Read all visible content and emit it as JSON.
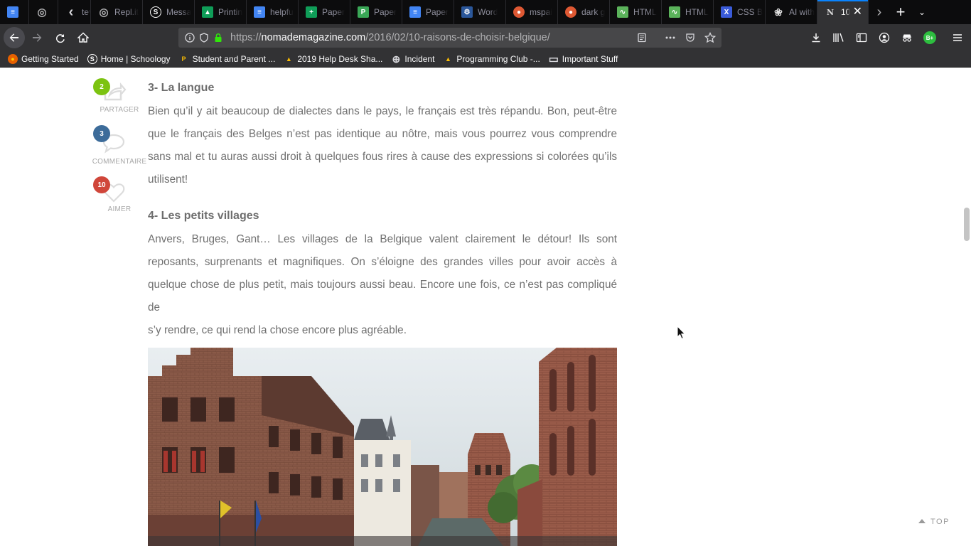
{
  "browser": {
    "tabs": [
      {
        "title": "",
        "favicon": "docs-icon",
        "color": "#4285f4"
      },
      {
        "title": "",
        "favicon": "replit-swirl-icon",
        "color": "#888888"
      },
      {
        "title": "tev",
        "favicon": "chevron-left-icon",
        "color": "#888888"
      },
      {
        "title": "Repl.it",
        "favicon": "replit-swirl-icon",
        "color": "#888888"
      },
      {
        "title": "Messa",
        "favicon": "schoology-icon",
        "color": "#1f5aa8"
      },
      {
        "title": "Printin",
        "favicon": "drive-icon",
        "color": "#0f9d58"
      },
      {
        "title": "helpfu",
        "favicon": "docs-icon",
        "color": "#4285f4"
      },
      {
        "title": "Paper",
        "favicon": "sheets-icon",
        "color": "#0f9d58"
      },
      {
        "title": "Paper",
        "favicon": "paper-icon",
        "color": "#3aa757"
      },
      {
        "title": "Paper",
        "favicon": "docs-icon",
        "color": "#4285f4"
      },
      {
        "title": "Word",
        "favicon": "word-gear-icon",
        "color": "#2b579a"
      },
      {
        "title": "mspai",
        "favicon": "duckduckgo-icon",
        "color": "#de5833"
      },
      {
        "title": "dark g",
        "favicon": "duckduckgo-icon",
        "color": "#de5833"
      },
      {
        "title": "HTML",
        "favicon": "chart-icon",
        "color": "#5bb35b"
      },
      {
        "title": "HTML",
        "favicon": "chart-icon",
        "color": "#5bb35b"
      },
      {
        "title": "CSS B",
        "favicon": "x-icon",
        "color": "#3a5bd9"
      },
      {
        "title": "AI with",
        "favicon": "openai-icon",
        "color": "#cccccc"
      },
      {
        "title": "10",
        "favicon": "n-logo-icon",
        "color": "#111111",
        "active": true
      }
    ],
    "url_domain": "nomademagazine.com",
    "url_prefix": "https://",
    "url_path": "/2016/02/10-raisons-de-choisir-belgique/",
    "bookmarks": [
      {
        "label": "Getting Started",
        "icon": "firefox-icon"
      },
      {
        "label": "Home | Schoology",
        "icon": "schoology-icon"
      },
      {
        "label": "Student and Parent ...",
        "icon": "p-icon"
      },
      {
        "label": "2019 Help Desk Sha...",
        "icon": "drive-icon"
      },
      {
        "label": "Incident",
        "icon": "globe-icon"
      },
      {
        "label": "Programming Club -...",
        "icon": "drive-icon"
      },
      {
        "label": "Important Stuff",
        "icon": "folder-icon"
      }
    ],
    "profile_badge": "B+"
  },
  "share": {
    "partager": {
      "count": "2",
      "label": "PARTAGER",
      "color": "#7cc311"
    },
    "commentaire": {
      "count": "3",
      "label": "COMMENTAIRE",
      "color": "#3d6c9a"
    },
    "aimer": {
      "count": "10",
      "label": "AIMER",
      "color": "#d0463a"
    }
  },
  "article": {
    "section3": {
      "heading": "3- La langue",
      "lines": [
        "Bien qu’il y ait beaucoup de dialectes dans le pays, le français est très répandu. Bon, peut-être",
        "que le français des Belges n’est pas identique au nôtre, mais vous pourrez vous comprendre",
        "sans mal et tu auras aussi droit à quelques fous rires à cause des expressions si colorées qu’ils",
        "utilisent!"
      ]
    },
    "section4": {
      "heading": "4- Les petits villages",
      "lines": [
        "Anvers, Bruges, Gant… Les villages de la Belgique valent clairement le détour! Ils sont",
        "reposants, surprenants et magnifiques. On s’éloigne des grandes villes pour avoir accès à",
        "quelque chose de plus petit, mais toujours aussi beau. Encore une fois, ce n’est pas compliqué de",
        "s’y rendre, ce qui rend la chose encore plus agréable."
      ]
    }
  },
  "top_link": "TOP"
}
